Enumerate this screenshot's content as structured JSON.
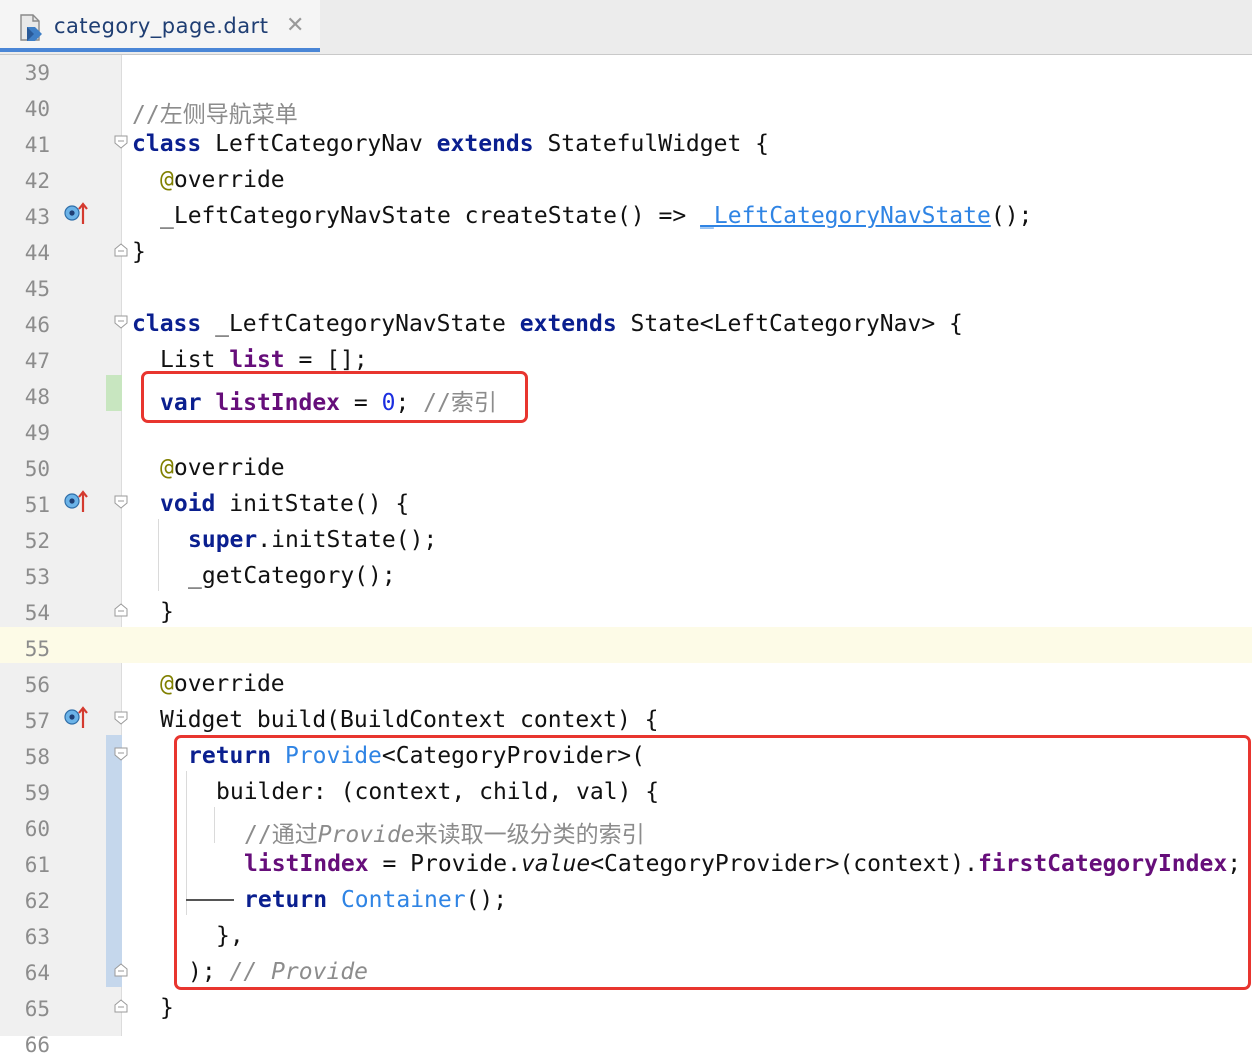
{
  "tab": {
    "title": "category_page.dart",
    "close": "✕"
  },
  "lines": [
    {
      "n": "39"
    },
    {
      "n": "40"
    },
    {
      "n": "41"
    },
    {
      "n": "42"
    },
    {
      "n": "43"
    },
    {
      "n": "44"
    },
    {
      "n": "45"
    },
    {
      "n": "46"
    },
    {
      "n": "47"
    },
    {
      "n": "48"
    },
    {
      "n": "49"
    },
    {
      "n": "50"
    },
    {
      "n": "51"
    },
    {
      "n": "52"
    },
    {
      "n": "53"
    },
    {
      "n": "54"
    },
    {
      "n": "55"
    },
    {
      "n": "56"
    },
    {
      "n": "57"
    },
    {
      "n": "58"
    },
    {
      "n": "59"
    },
    {
      "n": "60"
    },
    {
      "n": "61"
    },
    {
      "n": "62"
    },
    {
      "n": "63"
    },
    {
      "n": "64"
    },
    {
      "n": "65"
    },
    {
      "n": "66"
    }
  ],
  "code": {
    "l40": {
      "c": "//左侧导航菜单"
    },
    "l41": {
      "kw1": "class",
      "t1": " LeftCategoryNav ",
      "kw2": "extends",
      "t2": " StatefulWidget {"
    },
    "l42": {
      "at": "@",
      "t": "override"
    },
    "l43": {
      "t1": "_LeftCategoryNavState createState() => ",
      "cls": "_LeftCategoryNavState",
      "t2": "();"
    },
    "l44": {
      "t": "}"
    },
    "l46": {
      "kw1": "class",
      "t1": " _LeftCategoryNavState ",
      "kw2": "extends",
      "t2": " State<LeftCategoryNav> {"
    },
    "l47": {
      "t1": "List ",
      "f": "list",
      "t2": " = [];"
    },
    "l48": {
      "kw": "var",
      "sp": " ",
      "f": "listIndex",
      "t1": " = ",
      "num": "0",
      "t2": "; ",
      "c": "//索引"
    },
    "l50": {
      "at": "@",
      "t": "override"
    },
    "l51": {
      "kw": "void",
      "t": " initState() {"
    },
    "l52": {
      "kw": "super",
      "t": ".initState();"
    },
    "l53": {
      "t": "_getCategory();"
    },
    "l54": {
      "t": "}"
    },
    "l56": {
      "at": "@",
      "t": "override"
    },
    "l57": {
      "t": "Widget build(BuildContext context) {"
    },
    "l58": {
      "kw": "return",
      "sp": " ",
      "cls": "Provide",
      "t": "<CategoryProvider>("
    },
    "l59": {
      "t": "builder: (context, child, val) {"
    },
    "l60": {
      "c1": "//通过",
      "c2": "Provide",
      "c3": "来读取一级分类的索引"
    },
    "l61": {
      "f": "listIndex",
      "t1": " = Provide.",
      "it": "value",
      "t2": "<CategoryProvider>(context).",
      "f2": "firstCategoryIndex",
      "t3": ";"
    },
    "l62": {
      "kw": "return",
      "sp": " ",
      "cls": "Container",
      "t": "();"
    },
    "l63": {
      "t": "},"
    },
    "l64": {
      "t": "); ",
      "c": "// Provide"
    },
    "l65": {
      "t": "}"
    }
  },
  "colors": {
    "keyword": "#0a1f8f",
    "annotation": "#808000",
    "field": "#660e7a",
    "class_ref": "#2f84e4",
    "number": "#1b2ee0",
    "comment": "#8c8c8c",
    "highlight_box": "#e8352f",
    "tab_accent": "#4a86d6"
  },
  "icons": {
    "tab": "dart-file-icon",
    "override": "override-marker-icon",
    "fold": "fold-marker-icon"
  }
}
